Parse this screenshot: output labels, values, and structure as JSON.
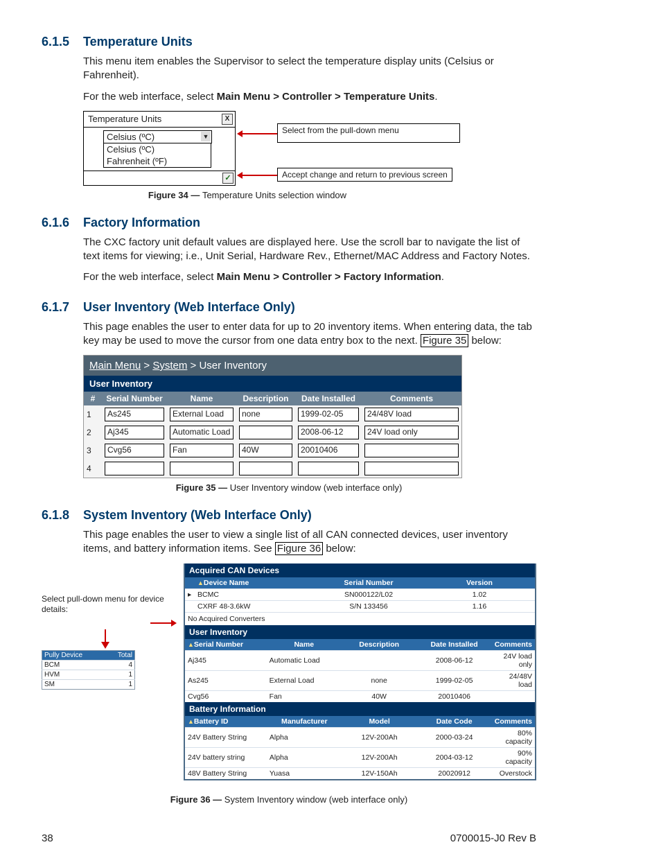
{
  "sections": {
    "s1": {
      "num": "6.1.5",
      "title": "Temperature Units",
      "p1": "This menu item enables the Supervisor to select the temperature display units (Celsius or Fahrenheit).",
      "p2a": "For the web interface, select ",
      "p2b": "Main Menu > Controller > Temperature Units",
      "p2c": "."
    },
    "s2": {
      "num": "6.1.6",
      "title": "Factory Information",
      "p1": "The CXC factory unit default values are displayed here. Use the scroll bar to navigate the list of text items for viewing; i.e., Unit Serial, Hardware Rev., Ethernet/MAC Address and Factory Notes.",
      "p2a": "For the web interface, select ",
      "p2b": "Main Menu > Controller > Factory Information",
      "p2c": "."
    },
    "s3": {
      "num": "6.1.7",
      "title": "User Inventory (Web Interface Only)",
      "p1a": "This page enables the user to enter data for up to 20 inventory items. When entering data, the tab key may be used to move the cursor from one data entry box to the next. ",
      "p1ref": "Figure 35",
      "p1b": " below:"
    },
    "s4": {
      "num": "6.1.8",
      "title": "System Inventory (Web Interface Only)",
      "p1a": "This page enables the user to view a single list of all CAN connected devices, user inventory items, and battery information items. See ",
      "p1ref": "Figure 36",
      "p1b": " below:"
    }
  },
  "fig34": {
    "win_title": "Temperature Units",
    "close": "X",
    "selected": "Celsius (ºC)",
    "opts": [
      "Celsius (ºC)",
      "Fahrenheit (ºF)"
    ],
    "ok": "✓",
    "call1": "Select from the pull-down menu",
    "call2": "Accept change and return to previous screen",
    "caption_b": "Figure 34  —  ",
    "caption": "Temperature Units selection window"
  },
  "fig35": {
    "bc": {
      "a": "Main Menu",
      "b": "System",
      "c": "User Inventory",
      "sep": " > "
    },
    "title": "User Inventory",
    "cols": [
      "#",
      "Serial Number",
      "Name",
      "Description",
      "Date Installed",
      "Comments"
    ],
    "rows": [
      {
        "n": "1",
        "sn": "As245",
        "name": "External Load",
        "desc": "none",
        "date": "1999-02-05",
        "com": "24/48V load"
      },
      {
        "n": "2",
        "sn": "Aj345",
        "name": "Automatic Load",
        "desc": "",
        "date": "2008-06-12",
        "com": "24V load only"
      },
      {
        "n": "3",
        "sn": "Cvg56",
        "name": "Fan",
        "desc": "40W",
        "date": "20010406",
        "com": ""
      },
      {
        "n": "4",
        "sn": "",
        "name": "",
        "desc": "",
        "date": "",
        "com": ""
      }
    ],
    "caption_b": "Figure 35  —  ",
    "caption": "User Inventory window (web interface only)"
  },
  "fig36": {
    "left_note": "Select pull-down menu for device details:",
    "mini_cols": [
      "Pully Device",
      "Total"
    ],
    "mini_rows": [
      {
        "a": "BCM",
        "b": "4"
      },
      {
        "a": "HVM",
        "b": "1"
      },
      {
        "a": "SM",
        "b": "1"
      }
    ],
    "can": {
      "title": "Acquired CAN Devices",
      "cols": [
        "Device Name",
        "Serial Number",
        "Version"
      ],
      "rows": [
        {
          "a": "BCMC",
          "b": "SN000122/L02",
          "c": "1.02",
          "arrow": "▸"
        },
        {
          "a": "CXRF 48-3.6kW",
          "b": "S/N 133456",
          "c": "1.16",
          "arrow": ""
        }
      ],
      "note": "No Acquired Converters"
    },
    "ui": {
      "title": "User Inventory",
      "cols": [
        "Serial Number",
        "Name",
        "Description",
        "Date Installed",
        "Comments"
      ],
      "rows": [
        {
          "a": "Aj345",
          "b": "Automatic Load",
          "c": "",
          "d": "2008-06-12",
          "e": "24V load only"
        },
        {
          "a": "As245",
          "b": "External Load",
          "c": "none",
          "d": "1999-02-05",
          "e": "24/48V load"
        },
        {
          "a": "Cvg56",
          "b": "Fan",
          "c": "40W",
          "d": "20010406",
          "e": ""
        }
      ]
    },
    "bi": {
      "title": "Battery Information",
      "cols": [
        "Battery ID",
        "Manufacturer",
        "Model",
        "Date Code",
        "Comments"
      ],
      "rows": [
        {
          "a": "24V Battery String",
          "b": "Alpha",
          "c": "12V-200Ah",
          "d": "2000-03-24",
          "e": "80% capacity"
        },
        {
          "a": "24V battery string",
          "b": "Alpha",
          "c": "12V-200Ah",
          "d": "2004-03-12",
          "e": "90% capacity"
        },
        {
          "a": "48V Battery String",
          "b": "Yuasa",
          "c": "12V-150Ah",
          "d": "20020912",
          "e": "Overstock"
        }
      ]
    },
    "caption_b": "Figure 36  —  ",
    "caption": "System Inventory window (web interface only)"
  },
  "footer": {
    "page": "38",
    "doc": "0700015-J0    Rev B"
  }
}
